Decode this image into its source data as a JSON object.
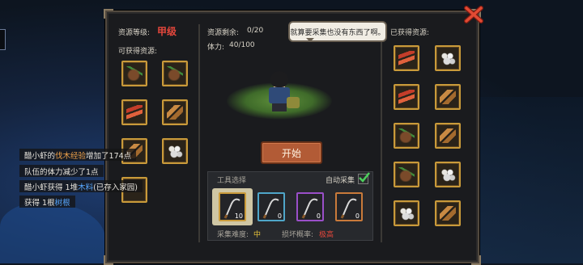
{
  "panel": {
    "level_label": "资源等级:",
    "level_value": "甲级",
    "available_label": "可获得资源:",
    "remaining_label": "资源剩余:",
    "remaining_value": "0/20",
    "stamina_label": "体力:",
    "stamina_value": "40/100",
    "obtained_label": "已获得资源:",
    "bubble_text": "就算要采集也没有东西了啊。",
    "start_label": "开始",
    "tool_select_label": "工具选择",
    "auto_collect_label": "自动采集",
    "auto_collect_checked": true,
    "difficulty_label": "采集难度:",
    "difficulty_value": "中",
    "break_label": "损坏概率:",
    "break_value": "极高"
  },
  "available_resources": [
    {
      "icon": "root-icon"
    },
    {
      "icon": "root-icon"
    },
    {
      "icon": "fiber-icon"
    },
    {
      "icon": "wood-icon"
    },
    {
      "icon": "wood-icon"
    },
    {
      "icon": "ore-icon"
    },
    {
      "icon": "unknown-icon"
    }
  ],
  "obtained_resources": [
    {
      "icon": "fiber-icon"
    },
    {
      "icon": "ore-icon"
    },
    {
      "icon": "fiber-icon"
    },
    {
      "icon": "wood-icon"
    },
    {
      "icon": "root-icon"
    },
    {
      "icon": "wood-icon"
    },
    {
      "icon": "root-icon"
    },
    {
      "icon": "ore-icon"
    },
    {
      "icon": "ore-icon"
    },
    {
      "icon": "wood-icon"
    }
  ],
  "tools": [
    {
      "name": "sickle-gold",
      "count": "10",
      "border": "#c99a3a"
    },
    {
      "name": "sickle-blue",
      "count": "0",
      "border": "#4fa6c9"
    },
    {
      "name": "sickle-purple",
      "count": "0",
      "border": "#9a4fc9"
    },
    {
      "name": "sickle-orange",
      "count": "0",
      "border": "#c97a3a"
    }
  ],
  "toasts": [
    {
      "pre": "醋小虾的",
      "hl": "伐木经验",
      "hl_color": "#f0a24a",
      "post": "增加了174点"
    },
    {
      "pre": "队伍的体力减少了1点",
      "hl": "",
      "hl_color": "",
      "post": ""
    },
    {
      "pre": "醋小虾获得 1堆",
      "hl": "木料",
      "hl_color": "#58a7ff",
      "post": "(已存入家园)"
    },
    {
      "pre": "获得 1根",
      "hl": "树根",
      "hl_color": "#58a7ff",
      "post": ""
    }
  ]
}
